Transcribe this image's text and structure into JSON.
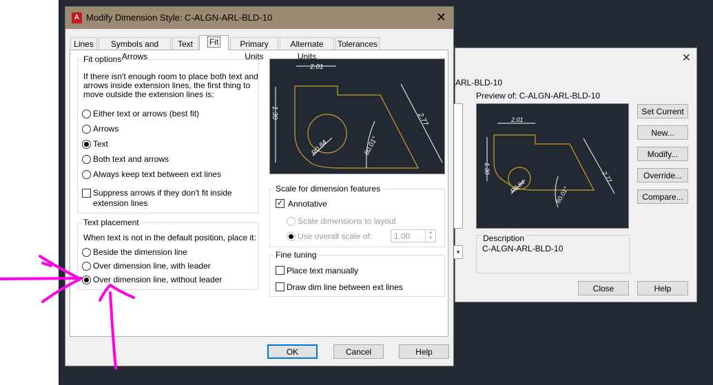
{
  "back_dialog": {
    "close_glyph": "✕",
    "style_name": "ARL-BLD-10",
    "preview_label": "Preview of: C-ALGN-ARL-BLD-10",
    "dropdown_glyph": "▾",
    "description_title": "Description",
    "description_value": "C-ALGN-ARL-BLD-10",
    "buttons": {
      "set_current": "Set Current",
      "new": "New...",
      "modify": "Modify...",
      "override": "Override...",
      "compare": "Compare...",
      "close": "Close",
      "help": "Help"
    }
  },
  "dialog": {
    "title": "Modify Dimension Style: C-ALGN-ARL-BLD-10",
    "icon_letter": "A",
    "close_glyph": "✕",
    "tabs": [
      "Lines",
      "Symbols and Arrows",
      "Text",
      "Fit",
      "Primary Units",
      "Alternate Units",
      "Tolerances"
    ],
    "active_tab": "Fit",
    "fit_options": {
      "title": "Fit options",
      "description": [
        "If there isn't enough room to place both text and",
        "arrows inside extension lines, the first thing to",
        "move outside the extension lines is:"
      ],
      "options": [
        "Either text or arrows (best fit)",
        "Arrows",
        "Text",
        "Both text and arrows",
        "Always keep text between ext lines"
      ],
      "selected": "Text",
      "suppress_label": [
        "Suppress arrows if they don't fit inside",
        "extension lines"
      ],
      "suppress_checked": false
    },
    "text_placement": {
      "title": "Text placement",
      "description": "When text is not in the default position, place it:",
      "options": [
        "Beside the dimension line",
        "Over dimension line, with leader",
        "Over dimension line, without leader"
      ],
      "selected": "Over dimension line, without leader"
    },
    "scale": {
      "title": "Scale for dimension features",
      "annotative_label": "Annotative",
      "annotative_checked": true,
      "scale_layout_label": "Scale dimensions to layout",
      "overall_scale_label": "Use overall scale of:",
      "overall_scale_value": "1.00",
      "spin_up": "▲",
      "spin_down": "▼"
    },
    "fine_tuning": {
      "title": "Fine tuning",
      "place_text_label": "Place text manually",
      "place_text_checked": false,
      "draw_dim_label": "Draw dim line between ext lines",
      "draw_dim_checked": false
    },
    "preview_dims": [
      "2.01",
      "1.30",
      "2.77",
      "R0.84",
      "60.01°"
    ],
    "buttons": {
      "ok": "OK",
      "cancel": "Cancel",
      "help": "Help"
    }
  },
  "colors": {
    "annotation_arrows": "#ff00e6",
    "titlebar": "#9a8b72",
    "preview_bg": "#232932",
    "preview_geometry": "#c9a227",
    "dark_background": "#232932"
  }
}
